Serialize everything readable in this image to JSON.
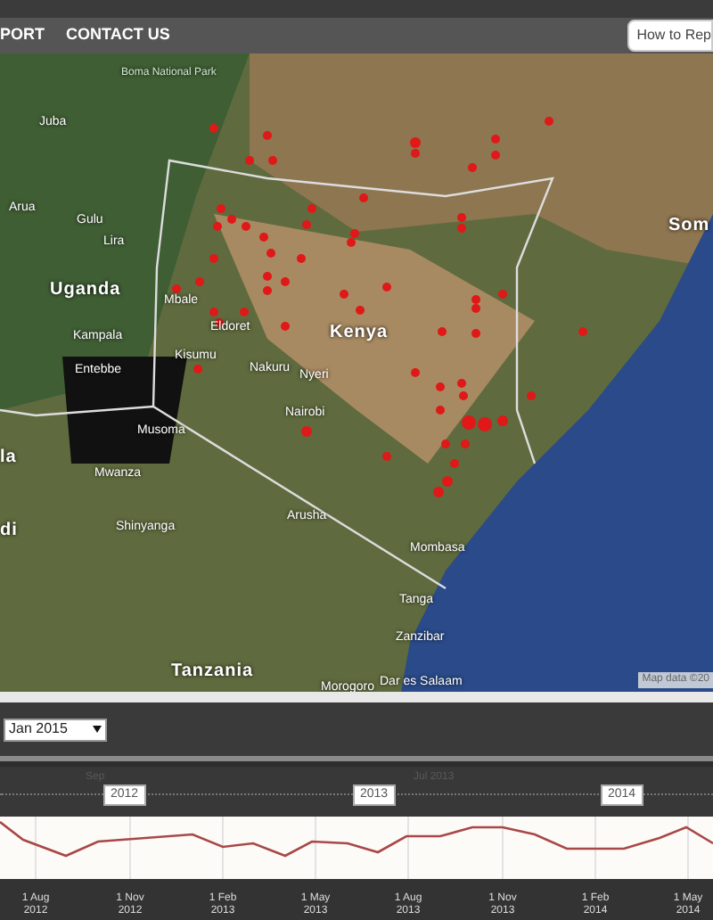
{
  "nav": {
    "items": [
      "PORT",
      "CONTACT US"
    ],
    "button": "How to Rep"
  },
  "map": {
    "labels": [
      {
        "text": "Boma National Park",
        "kind": "park"
      },
      {
        "text": "Juba",
        "kind": "city"
      },
      {
        "text": "Arua",
        "kind": "city"
      },
      {
        "text": "Gulu",
        "kind": "city"
      },
      {
        "text": "Lira",
        "kind": "city"
      },
      {
        "text": "Som",
        "kind": "country"
      },
      {
        "text": "Uganda",
        "kind": "country"
      },
      {
        "text": "Mbale",
        "kind": "city"
      },
      {
        "text": "Kampala",
        "kind": "city"
      },
      {
        "text": "Eldoret",
        "kind": "city"
      },
      {
        "text": "Kenya",
        "kind": "country"
      },
      {
        "text": "Kisumu",
        "kind": "city"
      },
      {
        "text": "Entebbe",
        "kind": "city"
      },
      {
        "text": "Nakuru",
        "kind": "city"
      },
      {
        "text": "Nyeri",
        "kind": "city"
      },
      {
        "text": "Nairobi",
        "kind": "city"
      },
      {
        "text": "Musoma",
        "kind": "city"
      },
      {
        "text": "la",
        "kind": "country"
      },
      {
        "text": "Mwanza",
        "kind": "city"
      },
      {
        "text": "di",
        "kind": "country"
      },
      {
        "text": "Shinyanga",
        "kind": "city"
      },
      {
        "text": "Arusha",
        "kind": "city"
      },
      {
        "text": "Mombasa",
        "kind": "city"
      },
      {
        "text": "Tanga",
        "kind": "city"
      },
      {
        "text": "Zanzibar",
        "kind": "city"
      },
      {
        "text": "Tanzania",
        "kind": "country"
      },
      {
        "text": "Morogoro",
        "kind": "city"
      },
      {
        "text": "Dar es Salaam",
        "kind": "city"
      }
    ],
    "attribution": "Map data ©20"
  },
  "month_select": {
    "value": "Jan 2015"
  },
  "timeline": {
    "navigator_labels": [
      {
        "text": "Sep",
        "kind": "faint"
      },
      {
        "text": "2012",
        "kind": "year"
      },
      {
        "text": "2013",
        "kind": "year"
      },
      {
        "text": "Jul 2013",
        "kind": "faint"
      },
      {
        "text": "2014",
        "kind": "year"
      }
    ],
    "x_ticks": [
      [
        "1 Aug",
        "2012"
      ],
      [
        "1 Nov",
        "2012"
      ],
      [
        "1 Feb",
        "2013"
      ],
      [
        "1 May",
        "2013"
      ],
      [
        "1 Aug",
        "2013"
      ],
      [
        "1 Nov",
        "2013"
      ],
      [
        "1 Feb",
        "2014"
      ],
      [
        "1 May",
        "2014"
      ]
    ]
  }
}
